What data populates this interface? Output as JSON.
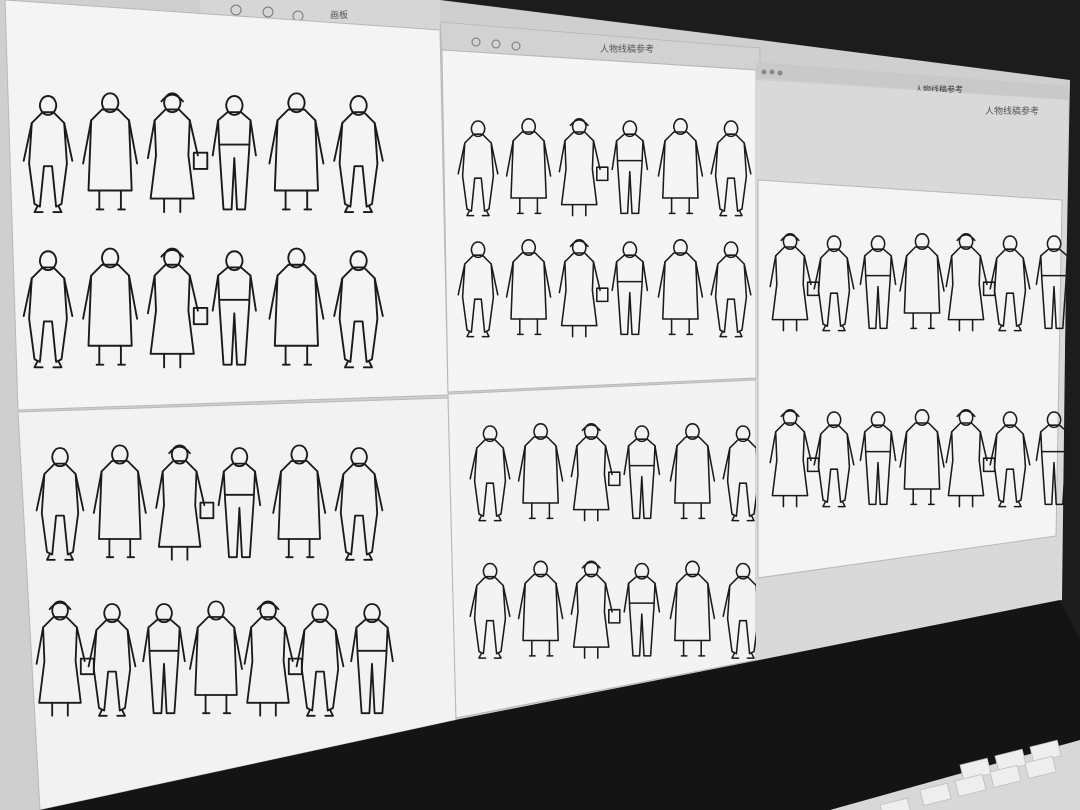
{
  "scene": {
    "description_free": true
  },
  "windows": [
    {
      "id": "left",
      "title": "画板"
    },
    {
      "id": "middle",
      "title": "人物线稿参考"
    },
    {
      "id": "right",
      "title": "人物线稿参考"
    }
  ],
  "menubar": {
    "right_text": "人物线稿参考"
  },
  "palette": {
    "background": "#1c1c1c",
    "screen": "#dcdcdc",
    "paper": "#f4f4f4",
    "ink": "#1a1a1a",
    "toolbar": "#cfcfcf"
  }
}
